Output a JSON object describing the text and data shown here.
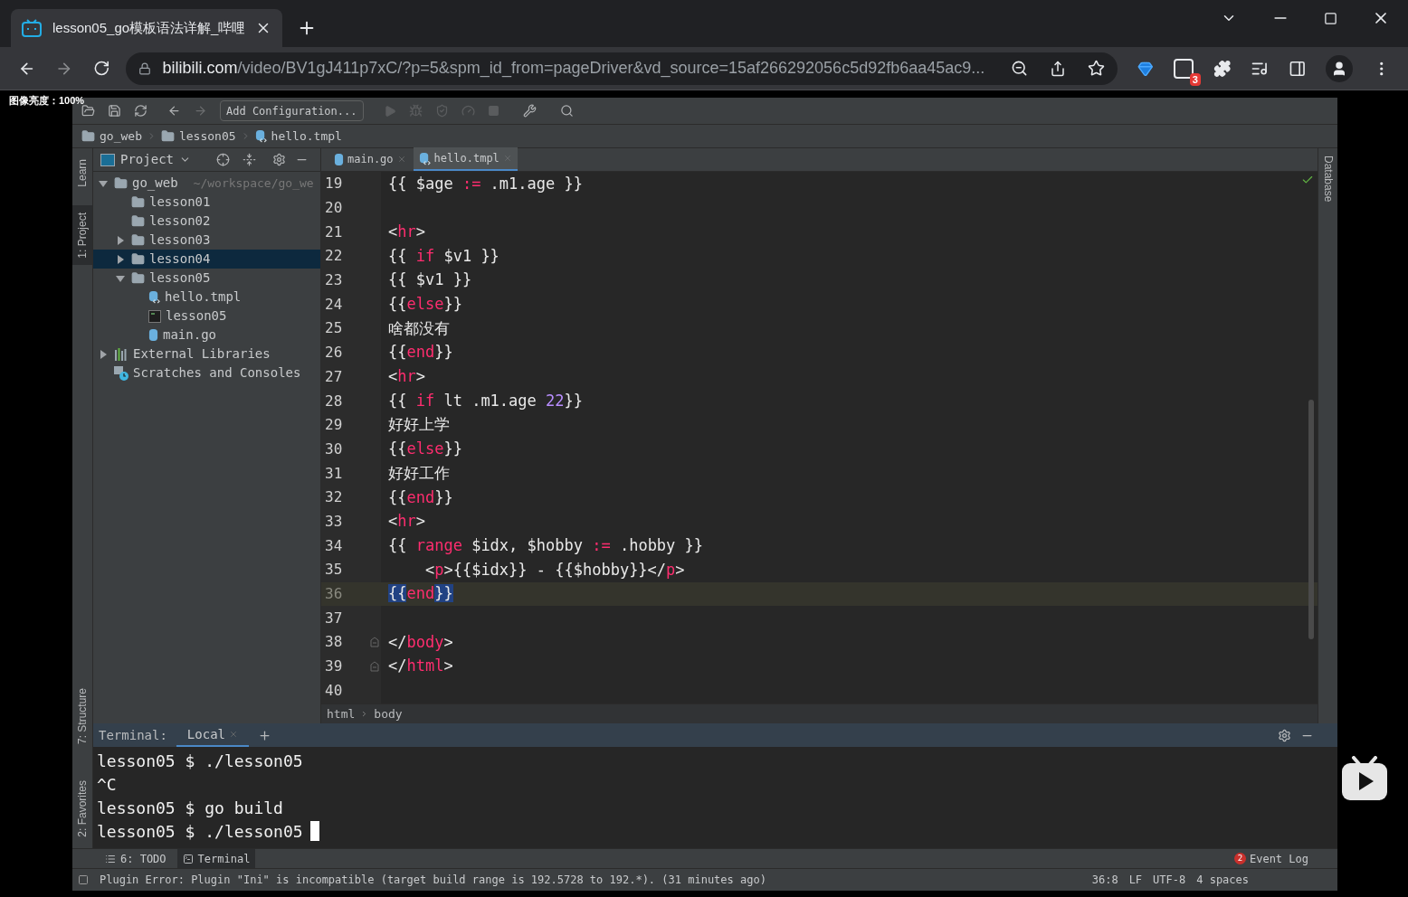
{
  "browser": {
    "tab": {
      "title": "lesson05_go模板语法详解_哔哩",
      "selected": true
    },
    "url": {
      "host": "bilibili.com",
      "path": "/video/BV1gJ411p7xC/?p=5&spm_id_from=pageDriver&vd_source=15af266292056c5d92fb6aa45ac9..."
    },
    "extension_badge": "3"
  },
  "overlay_label": "图像亮度：100%",
  "ide": {
    "toolbar": {
      "run_configuration": "Add Configuration..."
    },
    "breadcrumb": [
      {
        "label": "go_web",
        "kind": "folder"
      },
      {
        "label": "lesson05",
        "kind": "folder"
      },
      {
        "label": "hello.tmpl",
        "kind": "template"
      }
    ],
    "left_stripe": {
      "top": [
        {
          "label": "Learn",
          "selected": false
        },
        {
          "label": "1: Project",
          "selected": true
        }
      ],
      "bottom": [
        {
          "label": "7: Structure",
          "selected": false
        },
        {
          "label": "2: Favorites",
          "selected": false
        }
      ]
    },
    "right_stripe": [
      {
        "label": "Database",
        "selected": false
      }
    ],
    "project": {
      "title": "Project",
      "tree": [
        {
          "label": "go_web",
          "hint": "~/workspace/go_we",
          "kind": "folder",
          "expanded": true,
          "selected": false,
          "children": [
            {
              "label": "lesson01",
              "kind": "folder",
              "selected": false
            },
            {
              "label": "lesson02",
              "kind": "folder",
              "selected": false
            },
            {
              "label": "lesson03",
              "kind": "folder",
              "expanded": false,
              "selected": false
            },
            {
              "label": "lesson04",
              "kind": "folder",
              "expanded": false,
              "selected": true
            },
            {
              "label": "lesson05",
              "kind": "folder",
              "expanded": true,
              "selected": false,
              "children": [
                {
                  "label": "hello.tmpl",
                  "kind": "template",
                  "selected": false
                },
                {
                  "label": "lesson05",
                  "kind": "executable",
                  "selected": false
                },
                {
                  "label": "main.go",
                  "kind": "go",
                  "selected": false
                }
              ]
            }
          ]
        },
        {
          "label": "External Libraries",
          "kind": "libraries",
          "expanded": false,
          "selected": false
        },
        {
          "label": "Scratches and Consoles",
          "kind": "scratches",
          "selected": false
        }
      ]
    },
    "editor_tabs": [
      {
        "label": "main.go",
        "kind": "go",
        "selected": false
      },
      {
        "label": "hello.tmpl",
        "kind": "template",
        "selected": true
      }
    ],
    "code": [
      {
        "number": "19",
        "current": false,
        "fold": false,
        "segments": [
          {
            "text": "{{ $age ",
            "kind": "text"
          },
          {
            "text": ":=",
            "kind": "keyword"
          },
          {
            "text": " .m1.age }}",
            "kind": "text"
          }
        ]
      },
      {
        "number": "20",
        "current": false,
        "fold": false
      },
      {
        "number": "21",
        "current": false,
        "fold": false,
        "segments": [
          {
            "text": "<",
            "kind": "text"
          },
          {
            "text": "hr",
            "kind": "keyword"
          },
          {
            "text": ">",
            "kind": "text"
          }
        ]
      },
      {
        "number": "22",
        "current": false,
        "fold": false,
        "segments": [
          {
            "text": "{{ ",
            "kind": "text"
          },
          {
            "text": "if",
            "kind": "keyword"
          },
          {
            "text": " $v1 }}",
            "kind": "text"
          }
        ]
      },
      {
        "number": "23",
        "current": false,
        "fold": false,
        "segments": [
          {
            "text": "{{ $v1 }}",
            "kind": "text"
          }
        ]
      },
      {
        "number": "24",
        "current": false,
        "fold": false,
        "segments": [
          {
            "text": "{{",
            "kind": "text"
          },
          {
            "text": "else",
            "kind": "keyword"
          },
          {
            "text": "}}",
            "kind": "text"
          }
        ]
      },
      {
        "number": "25",
        "current": false,
        "fold": false,
        "segments": [
          {
            "text": "啥都没有",
            "kind": "text"
          }
        ]
      },
      {
        "number": "26",
        "current": false,
        "fold": false,
        "segments": [
          {
            "text": "{{",
            "kind": "text"
          },
          {
            "text": "end",
            "kind": "keyword"
          },
          {
            "text": "}}",
            "kind": "text"
          }
        ]
      },
      {
        "number": "27",
        "current": false,
        "fold": false,
        "segments": [
          {
            "text": "<",
            "kind": "text"
          },
          {
            "text": "hr",
            "kind": "keyword"
          },
          {
            "text": ">",
            "kind": "text"
          }
        ]
      },
      {
        "number": "28",
        "current": false,
        "fold": false,
        "segments": [
          {
            "text": "{{ ",
            "kind": "text"
          },
          {
            "text": "if",
            "kind": "keyword"
          },
          {
            "text": " lt .m1.age ",
            "kind": "text"
          },
          {
            "text": "22",
            "kind": "number"
          },
          {
            "text": "}}",
            "kind": "text"
          }
        ]
      },
      {
        "number": "29",
        "current": false,
        "fold": false,
        "segments": [
          {
            "text": "好好上学",
            "kind": "text"
          }
        ]
      },
      {
        "number": "30",
        "current": false,
        "fold": false,
        "segments": [
          {
            "text": "{{",
            "kind": "text"
          },
          {
            "text": "else",
            "kind": "keyword"
          },
          {
            "text": "}}",
            "kind": "text"
          }
        ]
      },
      {
        "number": "31",
        "current": false,
        "fold": false,
        "segments": [
          {
            "text": "好好工作",
            "kind": "text"
          }
        ]
      },
      {
        "number": "32",
        "current": false,
        "fold": false,
        "segments": [
          {
            "text": "{{",
            "kind": "text"
          },
          {
            "text": "end",
            "kind": "keyword"
          },
          {
            "text": "}}",
            "kind": "text"
          }
        ]
      },
      {
        "number": "33",
        "current": false,
        "fold": false,
        "segments": [
          {
            "text": "<",
            "kind": "text"
          },
          {
            "text": "hr",
            "kind": "keyword"
          },
          {
            "text": ">",
            "kind": "text"
          }
        ]
      },
      {
        "number": "34",
        "current": false,
        "fold": false,
        "segments": [
          {
            "text": "{{ ",
            "kind": "text"
          },
          {
            "text": "range",
            "kind": "keyword"
          },
          {
            "text": " $idx, $hobby ",
            "kind": "text"
          },
          {
            "text": ":=",
            "kind": "keyword"
          },
          {
            "text": " .hobby }}",
            "kind": "text"
          }
        ]
      },
      {
        "number": "35",
        "current": false,
        "fold": false,
        "segments": [
          {
            "text": "    <",
            "kind": "text"
          },
          {
            "text": "p",
            "kind": "keyword"
          },
          {
            "text": ">{{$idx}} - {{$hobby}}</",
            "kind": "text"
          },
          {
            "text": "p",
            "kind": "keyword"
          },
          {
            "text": ">",
            "kind": "text"
          }
        ]
      },
      {
        "number": "36",
        "current": true,
        "fold": false,
        "segments": [
          {
            "text": "{{",
            "kind": "match"
          },
          {
            "text": "end",
            "kind": "keyword"
          },
          {
            "text": "}}",
            "kind": "match"
          }
        ]
      },
      {
        "number": "37",
        "current": false,
        "fold": false
      },
      {
        "number": "38",
        "current": false,
        "fold": true,
        "segments": [
          {
            "text": "</",
            "kind": "text"
          },
          {
            "text": "body",
            "kind": "keyword"
          },
          {
            "text": ">",
            "kind": "text"
          }
        ]
      },
      {
        "number": "39",
        "current": false,
        "fold": true,
        "segments": [
          {
            "text": "</",
            "kind": "text"
          },
          {
            "text": "html",
            "kind": "keyword"
          },
          {
            "text": ">",
            "kind": "text"
          }
        ]
      },
      {
        "number": "40",
        "current": false,
        "fold": false
      }
    ],
    "code_breadcrumb": [
      "html",
      "body"
    ],
    "terminal": {
      "label": "Terminal:",
      "tabs": [
        {
          "label": "Local",
          "selected": true
        }
      ],
      "lines": [
        "lesson05 $ ./lesson05",
        "^C",
        "lesson05 $ go build",
        "lesson05 $ ./lesson05"
      ]
    },
    "tool_tabs": [
      {
        "label": "6: TODO",
        "kind": "todo",
        "selected": false
      },
      {
        "label": "Terminal",
        "kind": "terminal",
        "selected": true
      }
    ],
    "event_log": {
      "count": "2",
      "label": "Event Log"
    },
    "status": {
      "message": "Plugin Error: Plugin \"Ini\" is incompatible (target build range is 192.5728 to 192.*). (31 minutes ago)",
      "items": [
        "36:8",
        "LF",
        "UTF-8",
        "4 spaces"
      ]
    }
  }
}
